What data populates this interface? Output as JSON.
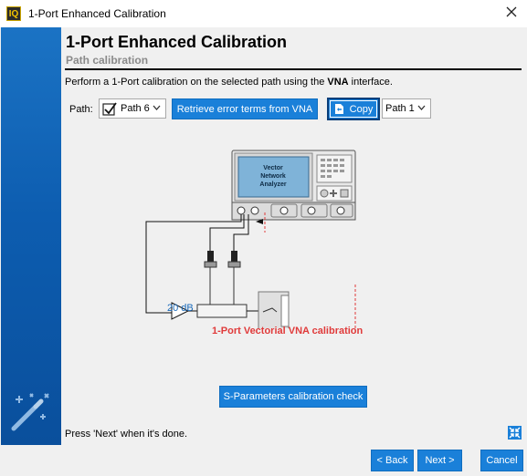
{
  "window": {
    "title": "1-Port Enhanced Calibration",
    "app_icon_text": "IQ"
  },
  "header": {
    "title": "1-Port Enhanced Calibration",
    "subtitle": "Path calibration"
  },
  "instruction": {
    "prefix": "Perform a 1-Port calibration on the selected path using the ",
    "emphasis": "VNA",
    "suffix": " interface."
  },
  "path_row": {
    "label": "Path:",
    "path_value": "Path 6",
    "retrieve_label": "Retrieve error terms from VNA",
    "copy_label": "Copy",
    "port_value": "Path 1"
  },
  "diagram": {
    "vna_label_lines": [
      "Vector",
      "Network",
      "Analyzer"
    ],
    "gain_label": "20 dB",
    "caption": "1-Port Vectorial VNA calibration"
  },
  "sparam_button": "S-Parameters calibration check",
  "hint": "Press 'Next' when it's done.",
  "footer": {
    "back": "< Back",
    "next": "Next >",
    "cancel": "Cancel"
  },
  "colors": {
    "accent": "#1a80d9",
    "sidebar": "#0d5db0",
    "caption_red": "#e03a3a",
    "gain_blue": "#1a6aba"
  }
}
